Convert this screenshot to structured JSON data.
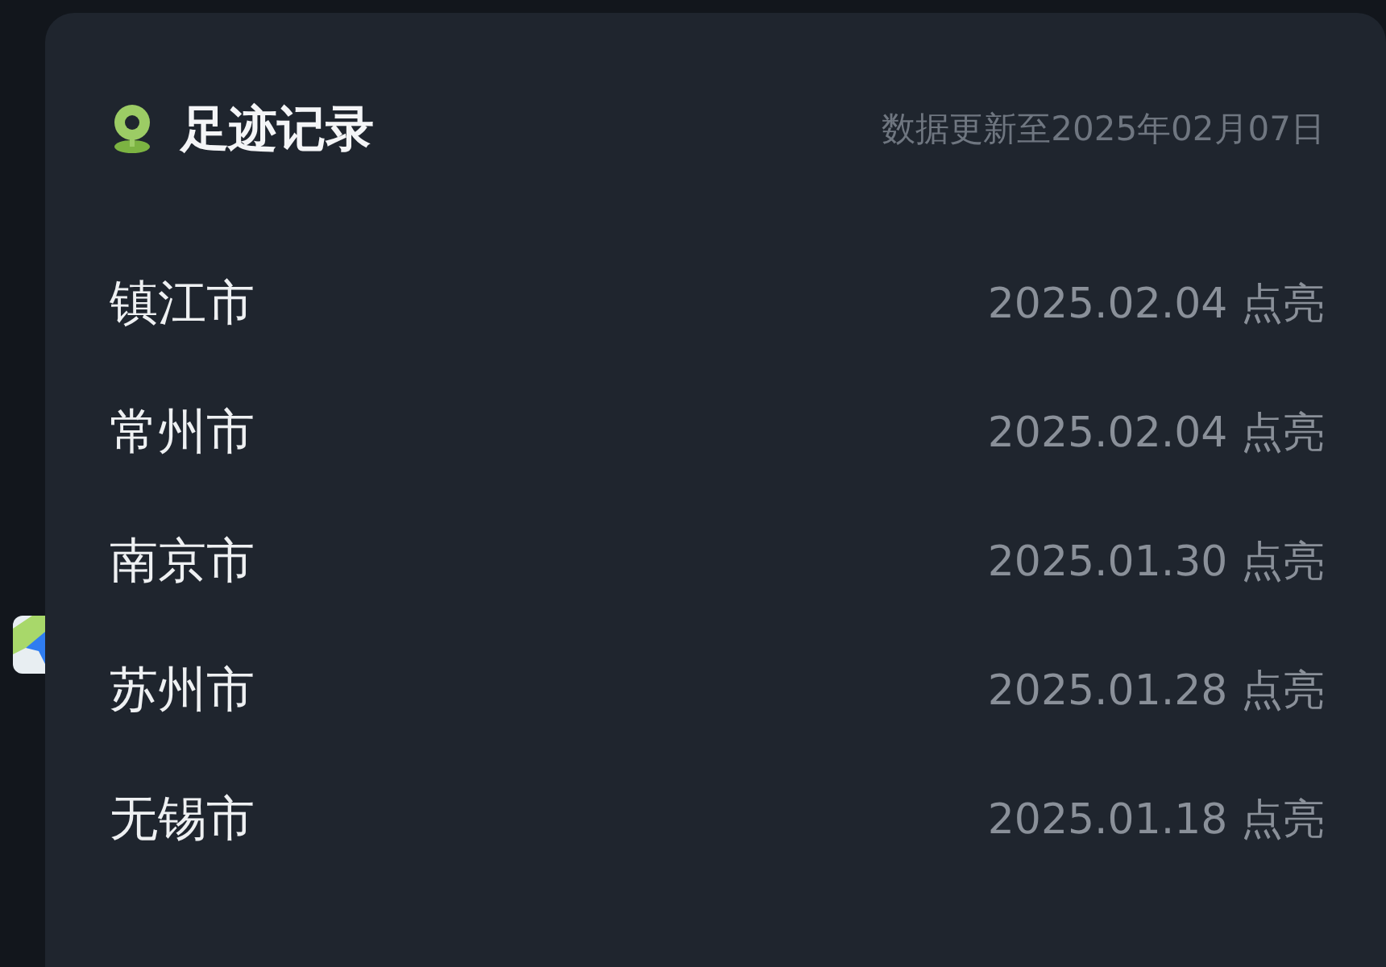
{
  "header": {
    "title": "足迹记录",
    "updated": "数据更新至2025年02月07日"
  },
  "records": [
    {
      "city": "镇江市",
      "date": "2025.02.04 点亮"
    },
    {
      "city": "常州市",
      "date": "2025.02.04 点亮"
    },
    {
      "city": "南京市",
      "date": "2025.01.30 点亮"
    },
    {
      "city": "苏州市",
      "date": "2025.01.28 点亮"
    },
    {
      "city": "无锡市",
      "date": "2025.01.18 点亮"
    }
  ]
}
